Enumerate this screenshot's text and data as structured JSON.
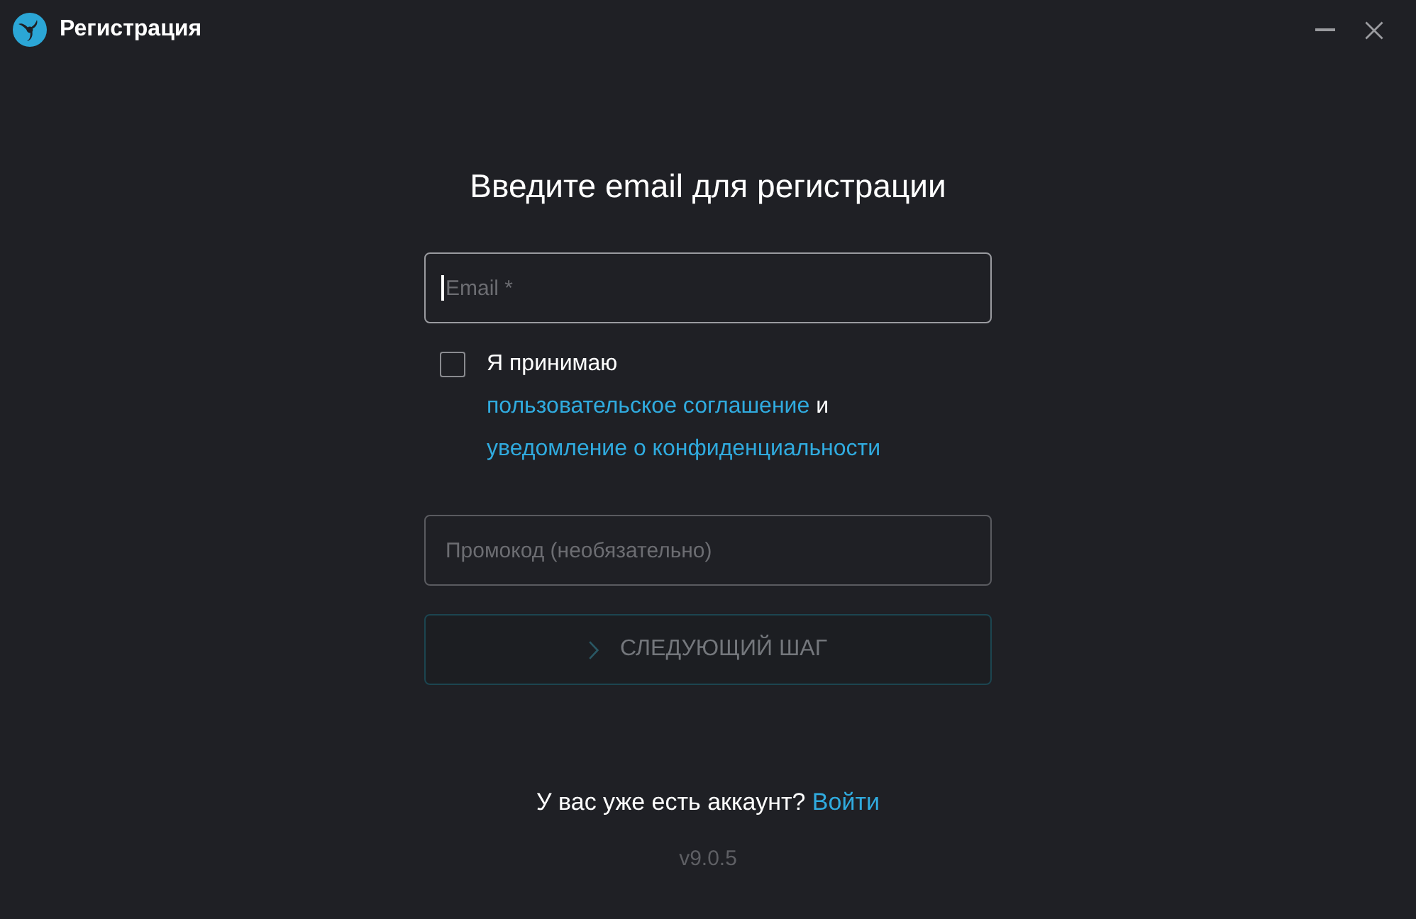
{
  "window": {
    "title": "Регистрация"
  },
  "heading": "Введите email для регистрации",
  "email_field": {
    "placeholder": "Email *",
    "focused": true
  },
  "agreement": {
    "checked": false,
    "text_before": "Я принимаю",
    "terms_link": "пользовательское соглашение",
    "text_between": "и",
    "privacy_link": "уведомление о конфиденциальности"
  },
  "promo_field": {
    "placeholder": "Промокод (необязательно)",
    "focused": false
  },
  "next_button": {
    "label": "СЛЕДУЮЩИЙ ШАГ",
    "disabled": true
  },
  "login_prompt": {
    "text": "У вас уже есть аккаунт?",
    "link": "Войти"
  },
  "version": "v9.0.5"
}
